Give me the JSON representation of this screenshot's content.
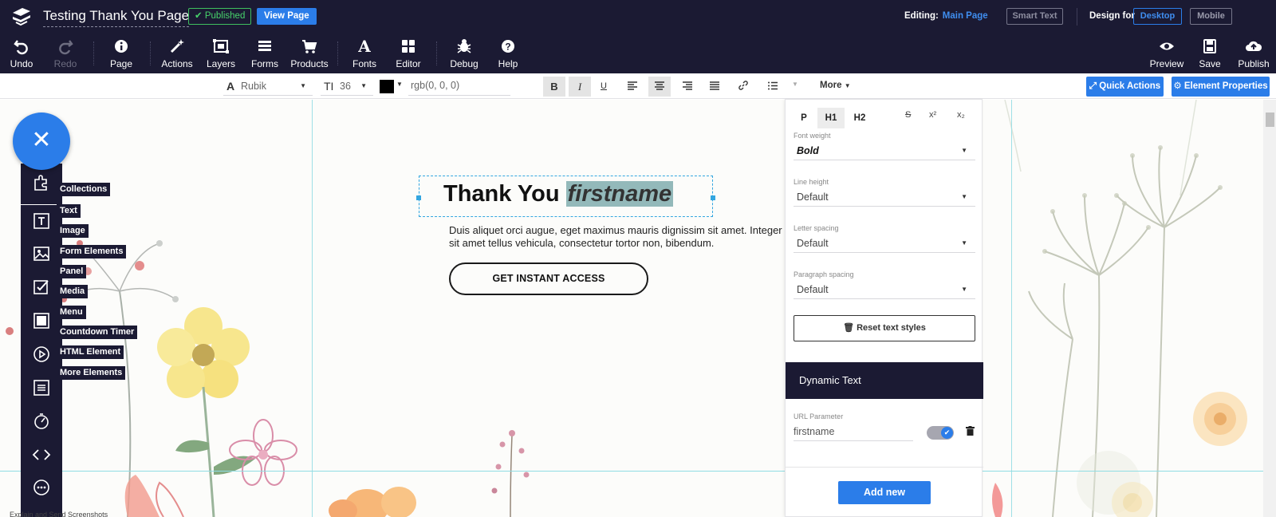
{
  "topbar": {
    "page_title": "Testing Thank You Page",
    "published_label": "Published",
    "view_page_label": "View Page",
    "editing_label": "Editing:",
    "editing_value": "Main Page",
    "smart_text_label": "Smart Text",
    "design_for_label": "Design for",
    "desktop_label": "Desktop",
    "mobile_label": "Mobile"
  },
  "toolbar": {
    "undo": "Undo",
    "redo": "Redo",
    "page": "Page",
    "actions": "Actions",
    "layers": "Layers",
    "forms": "Forms",
    "products": "Products",
    "fonts": "Fonts",
    "editor": "Editor",
    "debug": "Debug",
    "help": "Help",
    "preview": "Preview",
    "save": "Save",
    "publish": "Publish"
  },
  "formatbar": {
    "font": "Rubik",
    "size": "36",
    "color": "rgb(0, 0, 0)",
    "more_label": "More",
    "quick_actions_label": "Quick Actions",
    "element_properties_label": "Element Properties"
  },
  "canvas": {
    "heading_static": "Thank You ",
    "heading_dynamic": "firstname",
    "paragraph_line1": "Duis aliquet orci augue, eget maximus mauris dignissim sit amet. Integer",
    "paragraph_line2": "sit amet tellus vehicula, consectetur tortor non, bibendum.",
    "cta_label": "GET INSTANT ACCESS"
  },
  "elements_panel": {
    "tooltips": [
      "Collections",
      "Text",
      "Image",
      "Form Elements",
      "Panel",
      "Media",
      "Menu",
      "Countdown Timer",
      "HTML Element",
      "More Elements"
    ],
    "bottom_hint": "Explain and Send Screenshots"
  },
  "text_panel": {
    "tabs": [
      "P",
      "H1",
      "H2"
    ],
    "font_weight_label": "Font weight",
    "font_weight_value": "Bold",
    "line_height_label": "Line height",
    "line_height_value": "Default",
    "letter_spacing_label": "Letter spacing",
    "letter_spacing_value": "Default",
    "paragraph_spacing_label": "Paragraph spacing",
    "paragraph_spacing_value": "Default",
    "reset_label": "Reset text styles",
    "dynamic_text_title": "Dynamic Text",
    "url_parameter_label": "URL Parameter",
    "url_parameter_value": "firstname",
    "add_new_label": "Add new"
  },
  "colors": {
    "navy": "#1b1a33",
    "accent_blue": "#2b7de9",
    "published_green": "#47d36b",
    "highlight": "#93b9ba"
  }
}
